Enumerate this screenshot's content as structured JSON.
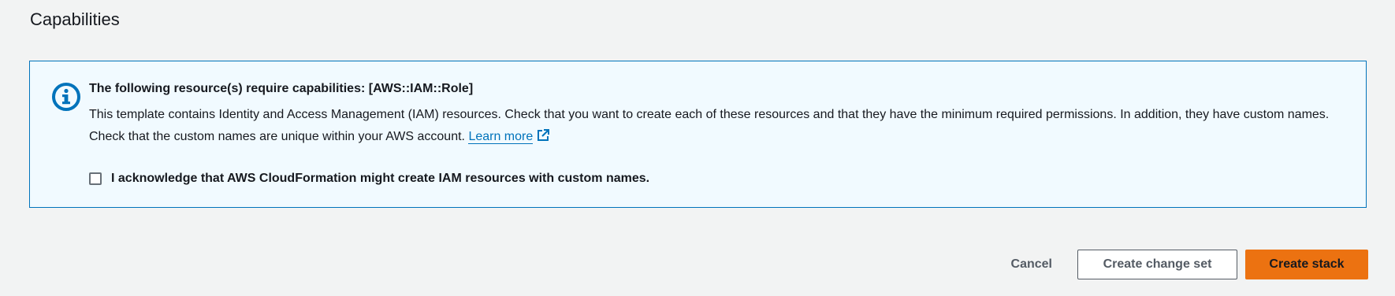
{
  "section": {
    "title": "Capabilities"
  },
  "alert": {
    "icon": "info-icon",
    "header": "The following resource(s) require capabilities: [AWS::IAM::Role]",
    "body": "This template contains Identity and Access Management (IAM) resources. Check that you want to create each of these resources and that they have the minimum required permissions. In addition, they have custom names. Check that the custom names are unique within your AWS account.",
    "learn_more": "Learn more",
    "external_icon": "external-link-icon",
    "acknowledge": {
      "label": "I acknowledge that AWS CloudFormation might create IAM resources with custom names.",
      "checked": false
    }
  },
  "actions": {
    "cancel": "Cancel",
    "create_change_set": "Create change set",
    "create_stack": "Create stack"
  },
  "colors": {
    "info_blue": "#0073bb",
    "primary_orange": "#ec7211",
    "page_background": "#f2f3f3"
  }
}
